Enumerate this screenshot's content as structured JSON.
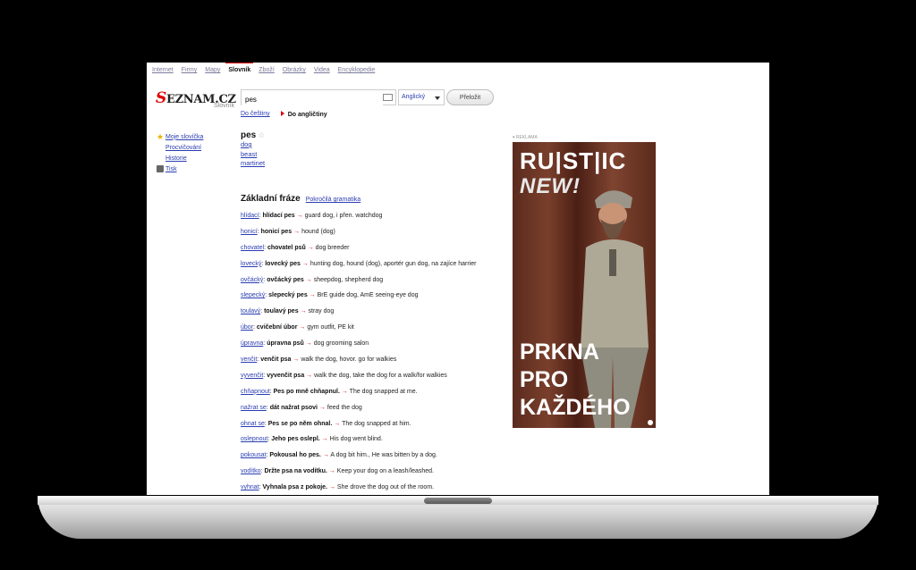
{
  "nav": {
    "items": [
      "Internet",
      "Firmy",
      "Mapy",
      "Slovník",
      "Zboží",
      "Obrázky",
      "Videa",
      "Encyklopedie"
    ],
    "active": "Slovník"
  },
  "logo": {
    "brand_prefix": "S",
    "brand_rest": "EZNAM.CZ",
    "sub": "Slovník"
  },
  "search": {
    "value": "pes",
    "keyboard_icon": "keyboard-icon"
  },
  "lang": {
    "selected": "Anglický"
  },
  "translate_button": "Přeložit",
  "direction": {
    "to_czech": "Do češtiny",
    "to_english": "Do angličtiny"
  },
  "sidebar": {
    "items": [
      "Moje slovíčka",
      "Procvičování",
      "Historie",
      "Tisk"
    ]
  },
  "entry": {
    "word": "pes",
    "translations": [
      "dog",
      "beast",
      "martinet"
    ]
  },
  "phrases_section": {
    "title": "Základní fráze",
    "advanced_link": "Pokročilá gramatika"
  },
  "phrases": [
    {
      "src": "hlídací",
      "cz": "hlídací pes",
      "en": "guard dog, i přen. watchdog"
    },
    {
      "src": "honicí",
      "cz": "honicí pes",
      "en": "hound (dog)"
    },
    {
      "src": "chovatel",
      "cz": "chovatel psů",
      "en": "dog breeder"
    },
    {
      "src": "lovecký",
      "cz": "lovecký pes",
      "en": "hunting dog, hound (dog), aportér gun dog, na zajíce harrier"
    },
    {
      "src": "ovčácký",
      "cz": "ovčácký pes",
      "en": "sheepdog, shepherd dog"
    },
    {
      "src": "slepecký",
      "cz": "slepecký pes",
      "en": "BrE guide dog, AmE seeing-eye dog"
    },
    {
      "src": "toulavý",
      "cz": "toulavý pes",
      "en": "stray dog"
    },
    {
      "src": "úbor",
      "cz": "cvičební úbor",
      "en": "gym outfit, PE kit"
    },
    {
      "src": "úpravna",
      "cz": "úpravna psů",
      "en": "dog grooming salon"
    },
    {
      "src": "venčit",
      "cz": "venčit psa",
      "en": "walk the dog, hovor. go for walkies"
    },
    {
      "src": "vyvenčit",
      "cz": "vyvenčit psa",
      "en": "walk the dog, take the dog for a walk/for walkies"
    },
    {
      "src": "chňapnout",
      "cz": "Pes po mně chňapnul.",
      "en": "The dog snapped at me."
    },
    {
      "src": "nažrat se",
      "cz": "dát nažrat psovi",
      "en": "feed the dog"
    },
    {
      "src": "ohnat se",
      "cz": "Pes se po něm ohnal.",
      "en": "The dog snapped at him."
    },
    {
      "src": "oslepnout",
      "cz": "Jeho pes oslepl.",
      "en": "His dog went blind."
    },
    {
      "src": "pokousat",
      "cz": "Pokousal ho pes.",
      "en": "A dog bit him., He was bitten by a dog."
    },
    {
      "src": "vodítko",
      "cz": "Držte psa na vodítku.",
      "en": "Keep your dog on a leash/leashed."
    },
    {
      "src": "vyhnat",
      "cz": "Vyhnala psa z pokoje.",
      "en": "She drove the dog out of the room."
    }
  ],
  "ad": {
    "label": "▾ REKLAMA",
    "line1": "RU|ST|IC",
    "line2": "NEW!",
    "slogan": [
      "PRKNA",
      "PRO",
      "KAŽDÉHO"
    ]
  }
}
